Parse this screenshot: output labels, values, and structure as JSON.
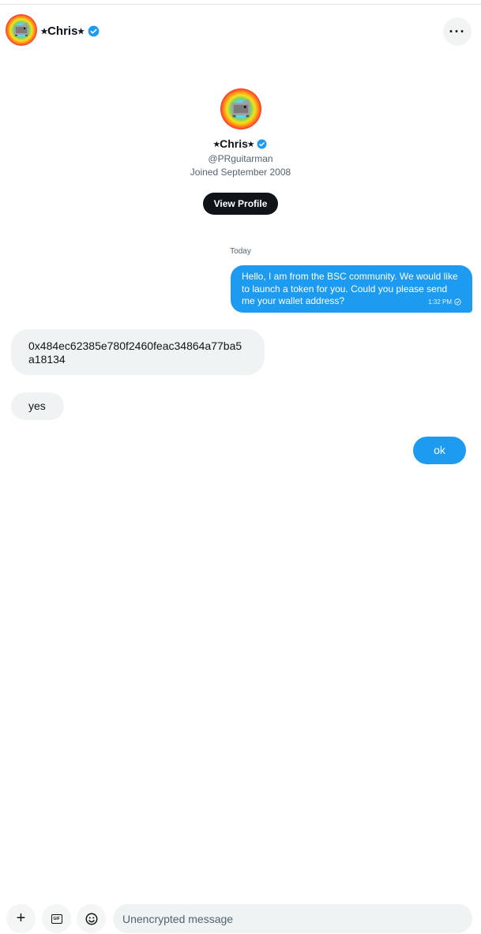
{
  "header": {
    "name": "⭒Chris⭒",
    "more_label": "···"
  },
  "profile": {
    "name": "⭒Chris⭒",
    "handle": "@PRguitarman",
    "joined": "Joined September 2008",
    "view_profile_label": "View Profile"
  },
  "conversation": {
    "date_separator": "Today",
    "messages": [
      {
        "direction": "outgoing",
        "text": "Hello, I am from the BSC community. We would like to launch a token for you. Could you please send me your wallet address?",
        "time": "1:32 PM"
      },
      {
        "direction": "incoming",
        "text": "0x484ec62385e780f2460feac34864a77ba5a18134"
      },
      {
        "direction": "incoming",
        "text": "yes"
      },
      {
        "direction": "outgoing",
        "text": "ok"
      }
    ]
  },
  "composer": {
    "plus_label": "+",
    "gif_label": "GIF",
    "placeholder": "Unencrypted message"
  },
  "colors": {
    "accent": "#1d9bf0",
    "incoming_bubble": "#eff3f4",
    "text": "#0f1419",
    "muted": "#536471"
  },
  "icons": [
    "verified-badge-icon",
    "more-icon",
    "plus-icon",
    "gif-icon",
    "emoji-icon",
    "read-receipt-icon"
  ]
}
